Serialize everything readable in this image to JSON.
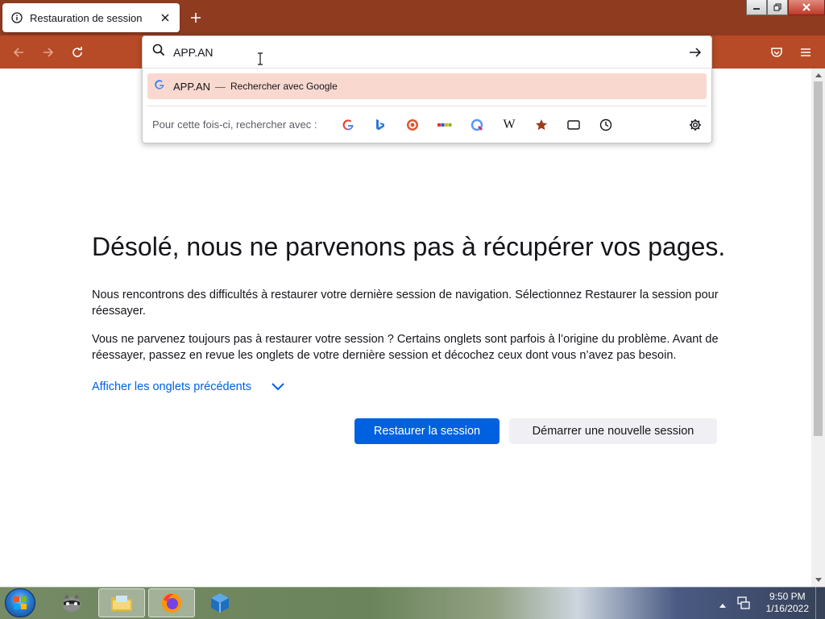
{
  "window": {
    "title_buttons": [
      "minimize-icon",
      "restore-icon",
      "close-icon"
    ]
  },
  "tab": {
    "title": "Restauration de session"
  },
  "urlbar": {
    "typed_value": "APP.AN",
    "suggestion": {
      "text": "APP.AN",
      "dash": "—",
      "action": "Rechercher avec Google"
    },
    "one_off_label": "Pour cette fois-ci, rechercher avec :",
    "engines": [
      "google-icon",
      "bing-icon",
      "duckduckgo-icon",
      "ebay-icon",
      "qwant-icon",
      "wikipedia-icon",
      "bookmarks-icon",
      "tabs-icon",
      "history-icon"
    ],
    "wikipedia_glyph": "W"
  },
  "content": {
    "title": "Désolé, nous ne parvenons pas à récupérer vos pages.",
    "p1": "Nous rencontrons des difficultés à restaurer votre dernière session de navigation. Sélectionnez Restaurer la session pour réessayer.",
    "p2": "Vous ne parvenez toujours pas à restaurer votre session ? Certains onglets sont parfois à l’origine du problème. Avant de réessayer, passez en revue les onglets de votre dernière session et décochez ceux dont vous n’avez pas besoin.",
    "show_tabs_link": "Afficher les onglets précédents",
    "restore_button": {
      "accesskey": "R",
      "rest": "estaurer la session"
    },
    "new_session_button": {
      "accesskey": "D",
      "rest": "émarrer une nouvelle session"
    }
  },
  "taskbar": {
    "clock_time": "9:50 PM",
    "clock_date": "1/16/2022"
  },
  "colors": {
    "tabstrip": "#8f3b1f",
    "navbar": "#b74b27",
    "accent": "#0061e0",
    "suggestion_highlight": "#f9d9cf"
  }
}
